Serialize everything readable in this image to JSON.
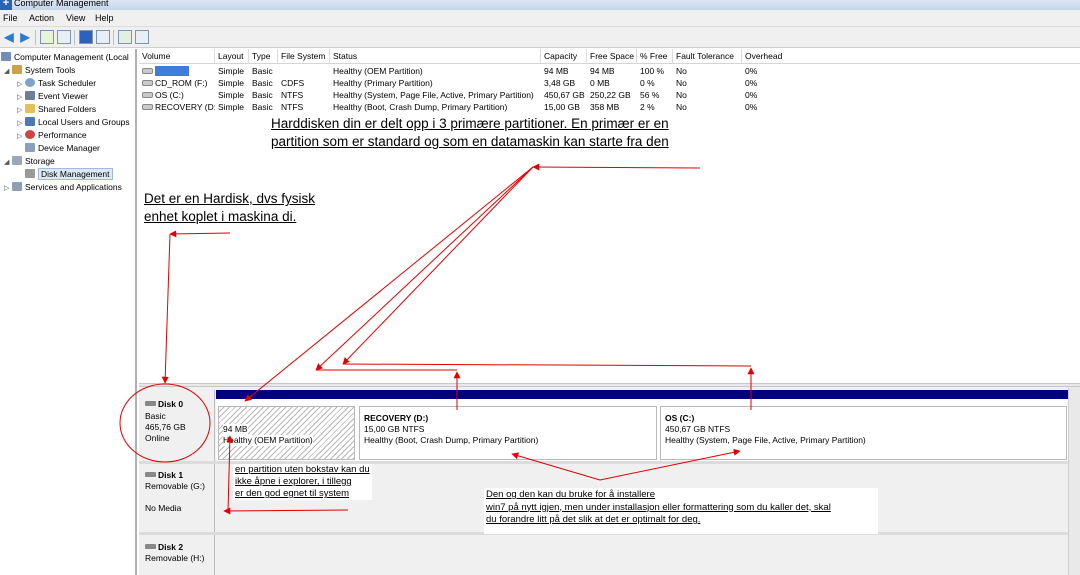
{
  "window": {
    "title": "Computer Management"
  },
  "menu": {
    "file": "File",
    "action": "Action",
    "view": "View",
    "help": "Help"
  },
  "tree": {
    "root": "Computer Management (Local",
    "system_tools": "System Tools",
    "task_scheduler": "Task Scheduler",
    "event_viewer": "Event Viewer",
    "shared_folders": "Shared Folders",
    "local_users": "Local Users and Groups",
    "performance": "Performance",
    "device_manager": "Device Manager",
    "storage": "Storage",
    "disk_management": "Disk Management",
    "services": "Services and Applications"
  },
  "volume_table": {
    "headers": {
      "volume": "Volume",
      "layout": "Layout",
      "type": "Type",
      "fs": "File System",
      "status": "Status",
      "capacity": "Capacity",
      "free": "Free Space",
      "pct": "% Free",
      "fault": "Fault Tolerance",
      "overhead": "Overhead"
    },
    "rows": [
      {
        "volume": "",
        "layout": "Simple",
        "type": "Basic",
        "fs": "",
        "status": "Healthy (OEM Partition)",
        "capacity": "94 MB",
        "free": "94 MB",
        "pct": "100 %",
        "fault": "No",
        "overhead": "0%"
      },
      {
        "volume": "CD_ROM (F:)",
        "layout": "Simple",
        "type": "Basic",
        "fs": "CDFS",
        "status": "Healthy (Primary Partition)",
        "capacity": "3,48 GB",
        "free": "0 MB",
        "pct": "0 %",
        "fault": "No",
        "overhead": "0%"
      },
      {
        "volume": "OS (C:)",
        "layout": "Simple",
        "type": "Basic",
        "fs": "NTFS",
        "status": "Healthy (System, Page File, Active, Primary Partition)",
        "capacity": "450,67 GB",
        "free": "250,22 GB",
        "pct": "56 %",
        "fault": "No",
        "overhead": "0%"
      },
      {
        "volume": "RECOVERY (D:)",
        "layout": "Simple",
        "type": "Basic",
        "fs": "NTFS",
        "status": "Healthy (Boot, Crash Dump, Primary Partition)",
        "capacity": "15,00 GB",
        "free": "358 MB",
        "pct": "2 %",
        "fault": "No",
        "overhead": "0%"
      }
    ]
  },
  "disks": {
    "disk0": {
      "name": "Disk 0",
      "kind": "Basic",
      "size": "465,76 GB",
      "state": "Online",
      "oem": {
        "size": "94 MB",
        "status": "Healthy (OEM Partition)"
      },
      "recovery": {
        "name": "RECOVERY  (D:)",
        "size": "15,00 GB NTFS",
        "status": "Healthy (Boot, Crash Dump, Primary Partition)"
      },
      "os": {
        "name": "OS  (C:)",
        "size": "450,67 GB NTFS",
        "status": "Healthy (System, Page File, Active, Primary Partition)"
      }
    },
    "disk1": {
      "name": "Disk 1",
      "kind": "Removable (G:)",
      "state": "No Media"
    },
    "disk2": {
      "name": "Disk 2",
      "kind": "Removable (H:)"
    }
  },
  "annotations": {
    "primary_line1": "Harddisken din er delt opp i 3 primære partitioner. En primær er en",
    "primary_line2": "partition som er standard og som en datamaskin kan starte fra den",
    "harddisk_line1": "Det er en Hardisk, dvs fysisk",
    "harddisk_line2": "enhet koplet i maskina di.",
    "oem_line1": "en partition uten bokstav kan du",
    "oem_line2": "ikke åpne i explorer, i tillegg",
    "oem_line3": " er den god egnet til system",
    "reinstall_line1": "Den og den kan du bruke for å installere",
    "reinstall_line2": "win7 på nytt igjen, men under installasjon eller formattering som du kaller det, skal",
    "reinstall_line3": "du forandre litt på det slik at det er optimalt for deg."
  },
  "colors": {
    "annotation": "#e00000",
    "partition_bar": "#000080",
    "selection": "#3b7fd9"
  }
}
